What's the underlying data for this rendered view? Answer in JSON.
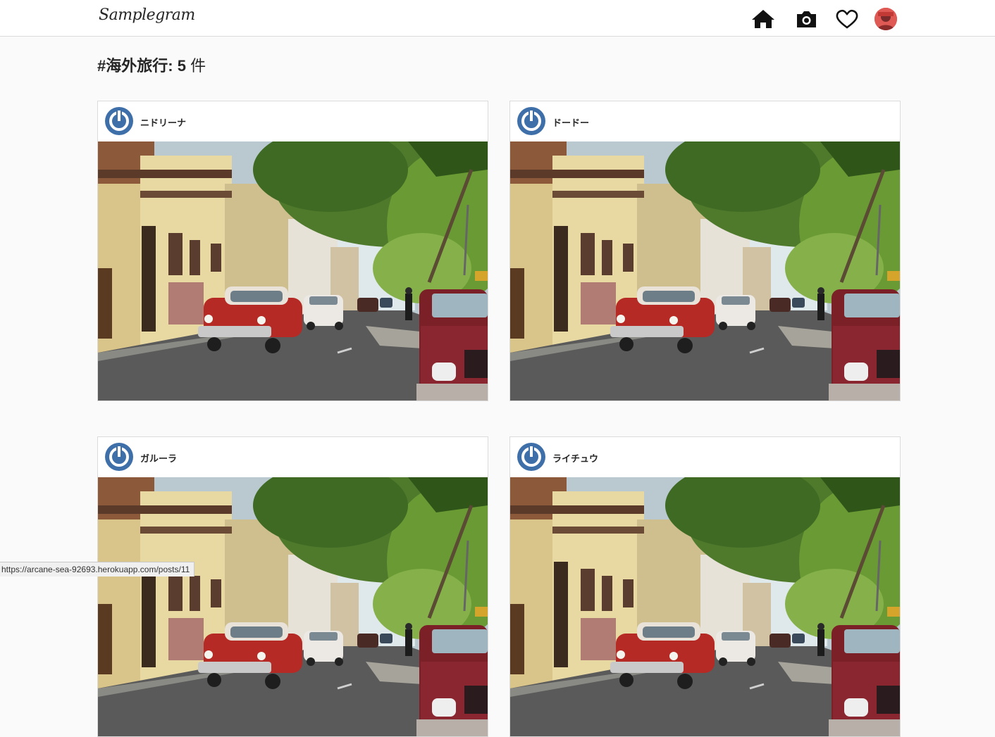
{
  "app": {
    "logo_text": "Samplegram"
  },
  "nav": {
    "icons": [
      "home-icon",
      "camera-icon",
      "heart-icon",
      "avatar"
    ]
  },
  "heading": {
    "tag": "#海外旅行",
    "count": "5",
    "unit": "件"
  },
  "posts": [
    {
      "username": "ニドリーナ"
    },
    {
      "username": "ドードー"
    },
    {
      "username": "ガルーラ"
    },
    {
      "username": "ライチュウ"
    }
  ],
  "status_bar": {
    "url": "https://arcane-sea-92693.herokuapp.com/posts/11"
  },
  "colors": {
    "avatar_blue": "#3e6fa9",
    "border": "#dbdbdb",
    "background": "#fafafa"
  }
}
